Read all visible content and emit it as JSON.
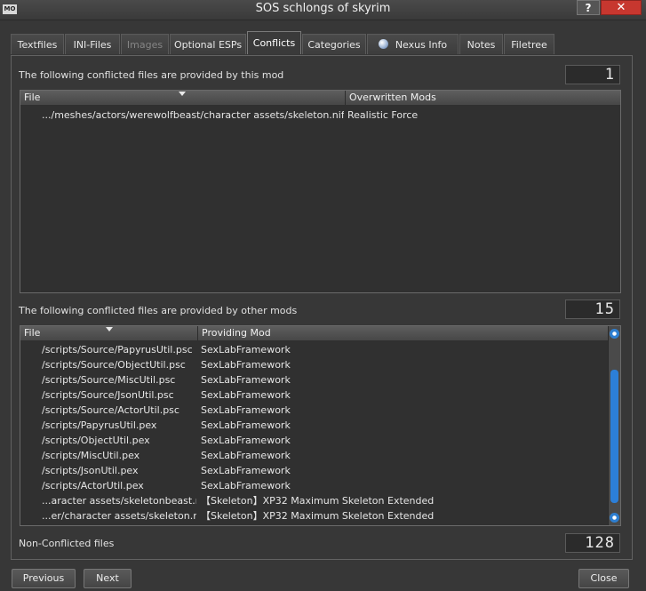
{
  "window": {
    "title": "SOS schlongs of skyrim",
    "app_icon_text": "MO",
    "help_label": "?",
    "close_label": "✕"
  },
  "tabs": [
    {
      "label": "Textfiles",
      "state": "normal"
    },
    {
      "label": "INI-Files",
      "state": "normal"
    },
    {
      "label": "Images",
      "state": "disabled"
    },
    {
      "label": "Optional ESPs",
      "state": "normal"
    },
    {
      "label": "Conflicts",
      "state": "active"
    },
    {
      "label": "Categories",
      "state": "normal"
    },
    {
      "label": "Nexus Info",
      "state": "normal",
      "icon": "globe-icon"
    },
    {
      "label": "Notes",
      "state": "normal"
    },
    {
      "label": "Filetree",
      "state": "normal"
    }
  ],
  "provided_section": {
    "label": "The following conflicted files are provided by this mod",
    "count": "1",
    "columns": [
      "File",
      "Overwritten Mods"
    ],
    "rows": [
      {
        "file": ".../meshes/actors/werewolfbeast/character assets/skeleton.nif",
        "mod": "Realistic Force"
      }
    ]
  },
  "overwritten_section": {
    "label": "The following conflicted files are provided by other mods",
    "count": "15",
    "columns": [
      "File",
      "Providing Mod"
    ],
    "rows": [
      {
        "file": "/scripts/Source/PapyrusUtil.psc",
        "mod": "SexLabFramework"
      },
      {
        "file": "/scripts/Source/ObjectUtil.psc",
        "mod": "SexLabFramework"
      },
      {
        "file": "/scripts/Source/MiscUtil.psc",
        "mod": "SexLabFramework"
      },
      {
        "file": "/scripts/Source/JsonUtil.psc",
        "mod": "SexLabFramework"
      },
      {
        "file": "/scripts/Source/ActorUtil.psc",
        "mod": "SexLabFramework"
      },
      {
        "file": "/scripts/PapyrusUtil.pex",
        "mod": "SexLabFramework"
      },
      {
        "file": "/scripts/ObjectUtil.pex",
        "mod": "SexLabFramework"
      },
      {
        "file": "/scripts/MiscUtil.pex",
        "mod": "SexLabFramework"
      },
      {
        "file": "/scripts/JsonUtil.pex",
        "mod": "SexLabFramework"
      },
      {
        "file": "/scripts/ActorUtil.pex",
        "mod": "SexLabFramework"
      },
      {
        "file": "...aracter assets/skeletonbeast.nif",
        "mod": "【Skeleton】XP32 Maximum Skeleton Extended"
      },
      {
        "file": "...er/character assets/skeleton.nif",
        "mod": "【Skeleton】XP32 Maximum Skeleton Extended"
      }
    ],
    "scroll_position": 0.75
  },
  "non_conflicted": {
    "label": "Non-Conflicted files",
    "count": "128"
  },
  "buttons": {
    "previous": "Previous",
    "next": "Next",
    "close": "Close"
  },
  "colors": {
    "accent": "#2c7fd8",
    "window_bg": "#373737",
    "close_red": "#c7372f"
  }
}
